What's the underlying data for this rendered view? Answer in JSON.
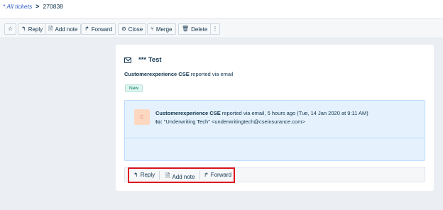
{
  "breadcrumb": {
    "all_tickets": "* All tickets",
    "separator": ">",
    "ticket_id": "270838"
  },
  "toolbar": {
    "reply": "Reply",
    "add_note": "Add note",
    "forward": "Forward",
    "close": "Close",
    "merge": "Merge",
    "delete": "Delete"
  },
  "icons": {
    "star": "☆",
    "reply": "↰",
    "note": "🗎",
    "forward": "↱",
    "close": "⊘",
    "merge": "⑂",
    "delete": "🗑",
    "more": "⋮"
  },
  "ticket": {
    "subject": "*** Test",
    "reporter_name": "Customerexperience CSE",
    "reporter_via": "reported via email",
    "status": "New"
  },
  "conversation": {
    "avatar_initial": "C",
    "sender": "Customerexperience CSE",
    "meta": "reported via email, 5 hours ago (Tue, 14 Jan 2020 at 9:11 AM)",
    "to_label": "to:",
    "to_value": "\"Underwriting Tech\" <underwritingtech@cseinsurance.com>"
  },
  "reply_bar": {
    "reply": "Reply",
    "add_note": "Add note",
    "forward": "Forward"
  },
  "colors": {
    "highlight": "#e0151e",
    "link": "#2c5cc5",
    "conversation_bg": "#e5f2fd"
  }
}
